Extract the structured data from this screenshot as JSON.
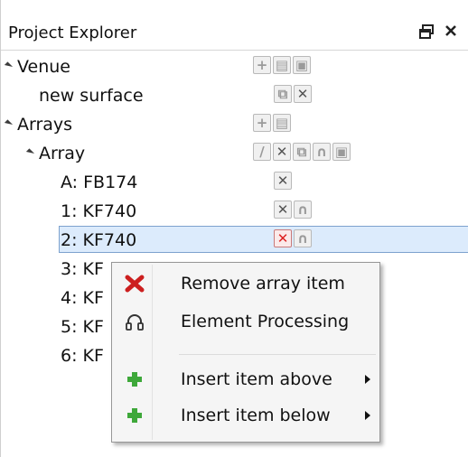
{
  "panel": {
    "title": "Project Explorer",
    "pin_glyph": "🗗",
    "close_glyph": "✕"
  },
  "tree": [
    {
      "label": "Venue",
      "expanded": true,
      "icons": [
        "plus-icon",
        "open-icon",
        "save-icon"
      ]
    },
    {
      "label": "new surface",
      "icons": [
        "copy-icon",
        "remove-icon"
      ]
    },
    {
      "label": "Arrays",
      "expanded": true,
      "icons": [
        "plus-icon",
        "open-icon"
      ]
    },
    {
      "label": "Array",
      "expanded": true,
      "icons": [
        "edit-icon",
        "remove-icon",
        "copy-icon",
        "headphones-icon",
        "save-icon"
      ]
    },
    {
      "label": "A: FB174",
      "icons": [
        "remove-icon"
      ]
    },
    {
      "label": "1: KF740",
      "icons": [
        "remove-icon",
        "headphones-icon"
      ]
    },
    {
      "label": "2: KF740",
      "selected": true,
      "icons": [
        "remove-icon",
        "headphones-icon"
      ]
    },
    {
      "label": "3: KF"
    },
    {
      "label": "4: KF"
    },
    {
      "label": "5: KF"
    },
    {
      "label": "6: KF"
    }
  ],
  "context_menu": {
    "items": [
      {
        "label": "Remove array item",
        "icon": "red-x-icon"
      },
      {
        "label": "Element Processing",
        "icon": "headphones-icon"
      },
      {
        "label": "Insert item above",
        "icon": "green-plus-icon",
        "submenu": true
      },
      {
        "label": "Insert item below",
        "icon": "green-plus-icon",
        "submenu": true
      }
    ]
  },
  "colors": {
    "selection": "#dcebfc",
    "selection_border": "#7da2ce",
    "remove_red": "#cc1f1f",
    "insert_green": "#3ea83a"
  }
}
